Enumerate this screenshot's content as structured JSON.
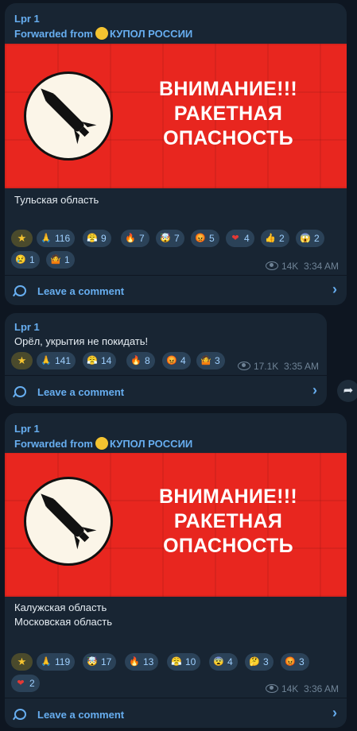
{
  "messages": [
    {
      "author": "Lpr 1",
      "forwarded_prefix": "Forwarded from",
      "channel": "КУПОЛ РОССИИ",
      "banner": {
        "line1": "ВНИМАНИЕ!!!",
        "line2": "РАКЕТНАЯ",
        "line3": "ОПАСНОСТЬ"
      },
      "text_lines": [
        "Тульская область"
      ],
      "reactions": [
        {
          "icon": "star-icon",
          "glyph": "★",
          "count": ""
        },
        {
          "icon": "pray-icon",
          "glyph": "🙏",
          "count": "116"
        },
        {
          "icon": "angry-steam-icon",
          "glyph": "😤",
          "count": "9"
        },
        {
          "icon": "fire-icon",
          "glyph": "🔥",
          "count": "7"
        },
        {
          "icon": "exploding-head-icon",
          "glyph": "🤯",
          "count": "7"
        },
        {
          "icon": "angry-face-icon",
          "glyph": "😡",
          "count": "5"
        },
        {
          "icon": "heart-icon",
          "glyph": "❤",
          "count": "4"
        },
        {
          "icon": "thumbs-up-icon",
          "glyph": "👍",
          "count": "2"
        },
        {
          "icon": "scream-icon",
          "glyph": "😱",
          "count": "2"
        },
        {
          "icon": "crying-icon",
          "glyph": "😢",
          "count": "1"
        },
        {
          "icon": "shrug-icon",
          "glyph": "🤷",
          "count": "1"
        }
      ],
      "views": "14K",
      "time": "3:34 AM",
      "comment_label": "Leave a comment"
    },
    {
      "author": "Lpr 1",
      "text_lines": [
        "Орёл, укрытия не покидать!"
      ],
      "reactions": [
        {
          "icon": "star-icon",
          "glyph": "★",
          "count": ""
        },
        {
          "icon": "pray-icon",
          "glyph": "🙏",
          "count": "141"
        },
        {
          "icon": "angry-steam-icon",
          "glyph": "😤",
          "count": "14"
        },
        {
          "icon": "fire-icon",
          "glyph": "🔥",
          "count": "8"
        },
        {
          "icon": "angry-face-icon",
          "glyph": "😡",
          "count": "4"
        },
        {
          "icon": "shrug-icon",
          "glyph": "🤷",
          "count": "3"
        }
      ],
      "views": "17.1K",
      "time": "3:35 AM",
      "comment_label": "Leave a comment"
    },
    {
      "author": "Lpr 1",
      "forwarded_prefix": "Forwarded from",
      "channel": "КУПОЛ РОССИИ",
      "banner": {
        "line1": "ВНИМАНИЕ!!!",
        "line2": "РАКЕТНАЯ",
        "line3": "ОПАСНОСТЬ"
      },
      "text_lines": [
        "Калужская область",
        "Московская область"
      ],
      "reactions": [
        {
          "icon": "star-icon",
          "glyph": "★",
          "count": ""
        },
        {
          "icon": "pray-icon",
          "glyph": "🙏",
          "count": "119"
        },
        {
          "icon": "exploding-head-icon",
          "glyph": "🤯",
          "count": "17"
        },
        {
          "icon": "fire-icon",
          "glyph": "🔥",
          "count": "13"
        },
        {
          "icon": "angry-steam-icon",
          "glyph": "😤",
          "count": "10"
        },
        {
          "icon": "fearful-icon",
          "glyph": "😨",
          "count": "4"
        },
        {
          "icon": "thinking-icon",
          "glyph": "🤔",
          "count": "3"
        },
        {
          "icon": "angry-face-icon",
          "glyph": "😡",
          "count": "3"
        },
        {
          "icon": "heart-icon",
          "glyph": "❤",
          "count": "2"
        }
      ],
      "views": "14K",
      "time": "3:36 AM",
      "comment_label": "Leave a comment"
    }
  ],
  "colors": {
    "background": "#0e1621",
    "bubble": "#182533",
    "accent": "#67aef0",
    "banner": "#e8261f"
  }
}
